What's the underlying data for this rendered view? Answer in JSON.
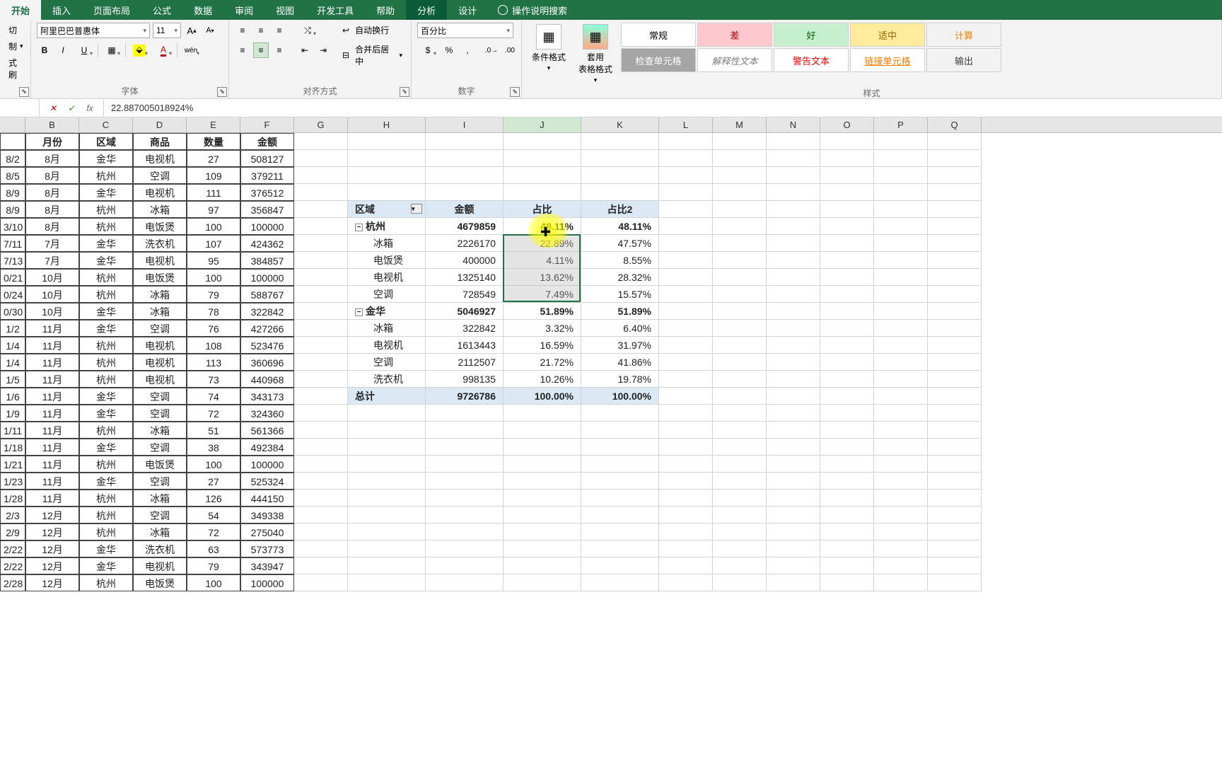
{
  "tabs": [
    "开始",
    "插入",
    "页面布局",
    "公式",
    "数据",
    "审阅",
    "视图",
    "开发工具",
    "帮助",
    "分析",
    "设计"
  ],
  "active_tab": 0,
  "context_active": "分析",
  "help_search": "操作说明搜索",
  "clipboard": {
    "cut": "切",
    "copy": "制",
    "brush": "式刷"
  },
  "font": {
    "name": "阿里巴巴普惠体",
    "size": "11",
    "bold": "B",
    "italic": "I",
    "underline": "U",
    "ruby": "wén"
  },
  "alignment": {
    "wrap": "自动换行",
    "merge": "合并后居中"
  },
  "number": {
    "format": "百分比"
  },
  "cond_format": "条件格式",
  "table_format": "套用\n表格格式",
  "styles": {
    "row1": [
      {
        "t": "常规",
        "bg": "#ffffff",
        "c": "#000"
      },
      {
        "t": "差",
        "bg": "#ffc7ce",
        "c": "#9c0006"
      },
      {
        "t": "好",
        "bg": "#c6efce",
        "c": "#006100"
      },
      {
        "t": "适中",
        "bg": "#ffeb9c",
        "c": "#9c6500"
      },
      {
        "t": "计算",
        "bg": "#f2f2f2",
        "c": "#fa7d00"
      }
    ],
    "row2": [
      {
        "t": "检查单元格",
        "bg": "#a5a5a5",
        "c": "#fff"
      },
      {
        "t": "解释性文本",
        "bg": "#fff",
        "c": "#7f7f7f",
        "i": true
      },
      {
        "t": "警告文本",
        "bg": "#fff",
        "c": "#ff0000"
      },
      {
        "t": "链接单元格",
        "bg": "#fff",
        "c": "#fa7d00",
        "u": true
      },
      {
        "t": "输出",
        "bg": "#f2f2f2",
        "c": "#3f3f3f"
      }
    ]
  },
  "group_labels": {
    "font": "字体",
    "align": "对齐方式",
    "number": "数字",
    "styles": "样式"
  },
  "formula_bar": {
    "value": "22.887005018924%"
  },
  "columns": [
    "B",
    "C",
    "D",
    "E",
    "F",
    "G",
    "H",
    "I",
    "J",
    "K",
    "L",
    "M",
    "N",
    "O",
    "P",
    "Q"
  ],
  "col_widths": [
    "w-B",
    "w-C",
    "w-D",
    "w-E",
    "w-F",
    "w-G",
    "w-H",
    "w-I",
    "w-J",
    "w-K",
    "w-L",
    "w-M",
    "w-N",
    "w-O",
    "w-P",
    "w-Q"
  ],
  "data_header": [
    "",
    "月份",
    "区域",
    "商品",
    "数量",
    "金额"
  ],
  "data_rows": [
    [
      "8/2",
      "8月",
      "金华",
      "电视机",
      "27",
      "508127"
    ],
    [
      "8/5",
      "8月",
      "杭州",
      "空调",
      "109",
      "379211"
    ],
    [
      "8/9",
      "8月",
      "金华",
      "电视机",
      "111",
      "376512"
    ],
    [
      "8/9",
      "8月",
      "杭州",
      "冰箱",
      "97",
      "356847"
    ],
    [
      "3/10",
      "8月",
      "杭州",
      "电饭煲",
      "100",
      "100000"
    ],
    [
      "7/11",
      "7月",
      "金华",
      "洗衣机",
      "107",
      "424362"
    ],
    [
      "7/13",
      "7月",
      "金华",
      "电视机",
      "95",
      "384857"
    ],
    [
      "0/21",
      "10月",
      "杭州",
      "电饭煲",
      "100",
      "100000"
    ],
    [
      "0/24",
      "10月",
      "杭州",
      "冰箱",
      "79",
      "588767"
    ],
    [
      "0/30",
      "10月",
      "金华",
      "冰箱",
      "78",
      "322842"
    ],
    [
      "1/2",
      "11月",
      "金华",
      "空调",
      "76",
      "427266"
    ],
    [
      "1/4",
      "11月",
      "杭州",
      "电视机",
      "108",
      "523476"
    ],
    [
      "1/4",
      "11月",
      "杭州",
      "电视机",
      "113",
      "360696"
    ],
    [
      "1/5",
      "11月",
      "杭州",
      "电视机",
      "73",
      "440968"
    ],
    [
      "1/6",
      "11月",
      "金华",
      "空调",
      "74",
      "343173"
    ],
    [
      "1/9",
      "11月",
      "金华",
      "空调",
      "72",
      "324360"
    ],
    [
      "1/11",
      "11月",
      "杭州",
      "冰箱",
      "51",
      "561366"
    ],
    [
      "1/18",
      "11月",
      "金华",
      "空调",
      "38",
      "492384"
    ],
    [
      "1/21",
      "11月",
      "杭州",
      "电饭煲",
      "100",
      "100000"
    ],
    [
      "1/23",
      "11月",
      "金华",
      "空调",
      "27",
      "525324"
    ],
    [
      "1/28",
      "11月",
      "杭州",
      "冰箱",
      "126",
      "444150"
    ],
    [
      "2/3",
      "12月",
      "杭州",
      "空调",
      "54",
      "349338"
    ],
    [
      "2/9",
      "12月",
      "杭州",
      "冰箱",
      "72",
      "275040"
    ],
    [
      "2/22",
      "12月",
      "金华",
      "洗衣机",
      "63",
      "573773"
    ],
    [
      "2/22",
      "12月",
      "金华",
      "电视机",
      "79",
      "343947"
    ],
    [
      "2/28",
      "12月",
      "杭州",
      "电饭煲",
      "100",
      "100000"
    ]
  ],
  "pivot": {
    "headers": [
      "区域",
      "金额",
      "占比",
      "占比2"
    ],
    "rows": [
      {
        "type": "parent",
        "label": "杭州",
        "amount": "4679859",
        "pct": "48.11%",
        "pct2": "48.11%"
      },
      {
        "type": "child",
        "label": "冰箱",
        "amount": "2226170",
        "pct": "22.89%",
        "pct2": "47.57%"
      },
      {
        "type": "child",
        "label": "电饭煲",
        "amount": "400000",
        "pct": "4.11%",
        "pct2": "8.55%"
      },
      {
        "type": "child",
        "label": "电视机",
        "amount": "1325140",
        "pct": "13.62%",
        "pct2": "28.32%"
      },
      {
        "type": "child",
        "label": "空调",
        "amount": "728549",
        "pct": "7.49%",
        "pct2": "15.57%"
      },
      {
        "type": "parent",
        "label": "金华",
        "amount": "5046927",
        "pct": "51.89%",
        "pct2": "51.89%"
      },
      {
        "type": "child",
        "label": "冰箱",
        "amount": "322842",
        "pct": "3.32%",
        "pct2": "6.40%"
      },
      {
        "type": "child",
        "label": "电视机",
        "amount": "1613443",
        "pct": "16.59%",
        "pct2": "31.97%"
      },
      {
        "type": "child",
        "label": "空调",
        "amount": "2112507",
        "pct": "21.72%",
        "pct2": "41.86%"
      },
      {
        "type": "child",
        "label": "洗衣机",
        "amount": "998135",
        "pct": "10.26%",
        "pct2": "19.78%"
      }
    ],
    "total": {
      "label": "总计",
      "amount": "9726786",
      "pct": "100.00%",
      "pct2": "100.00%"
    }
  }
}
